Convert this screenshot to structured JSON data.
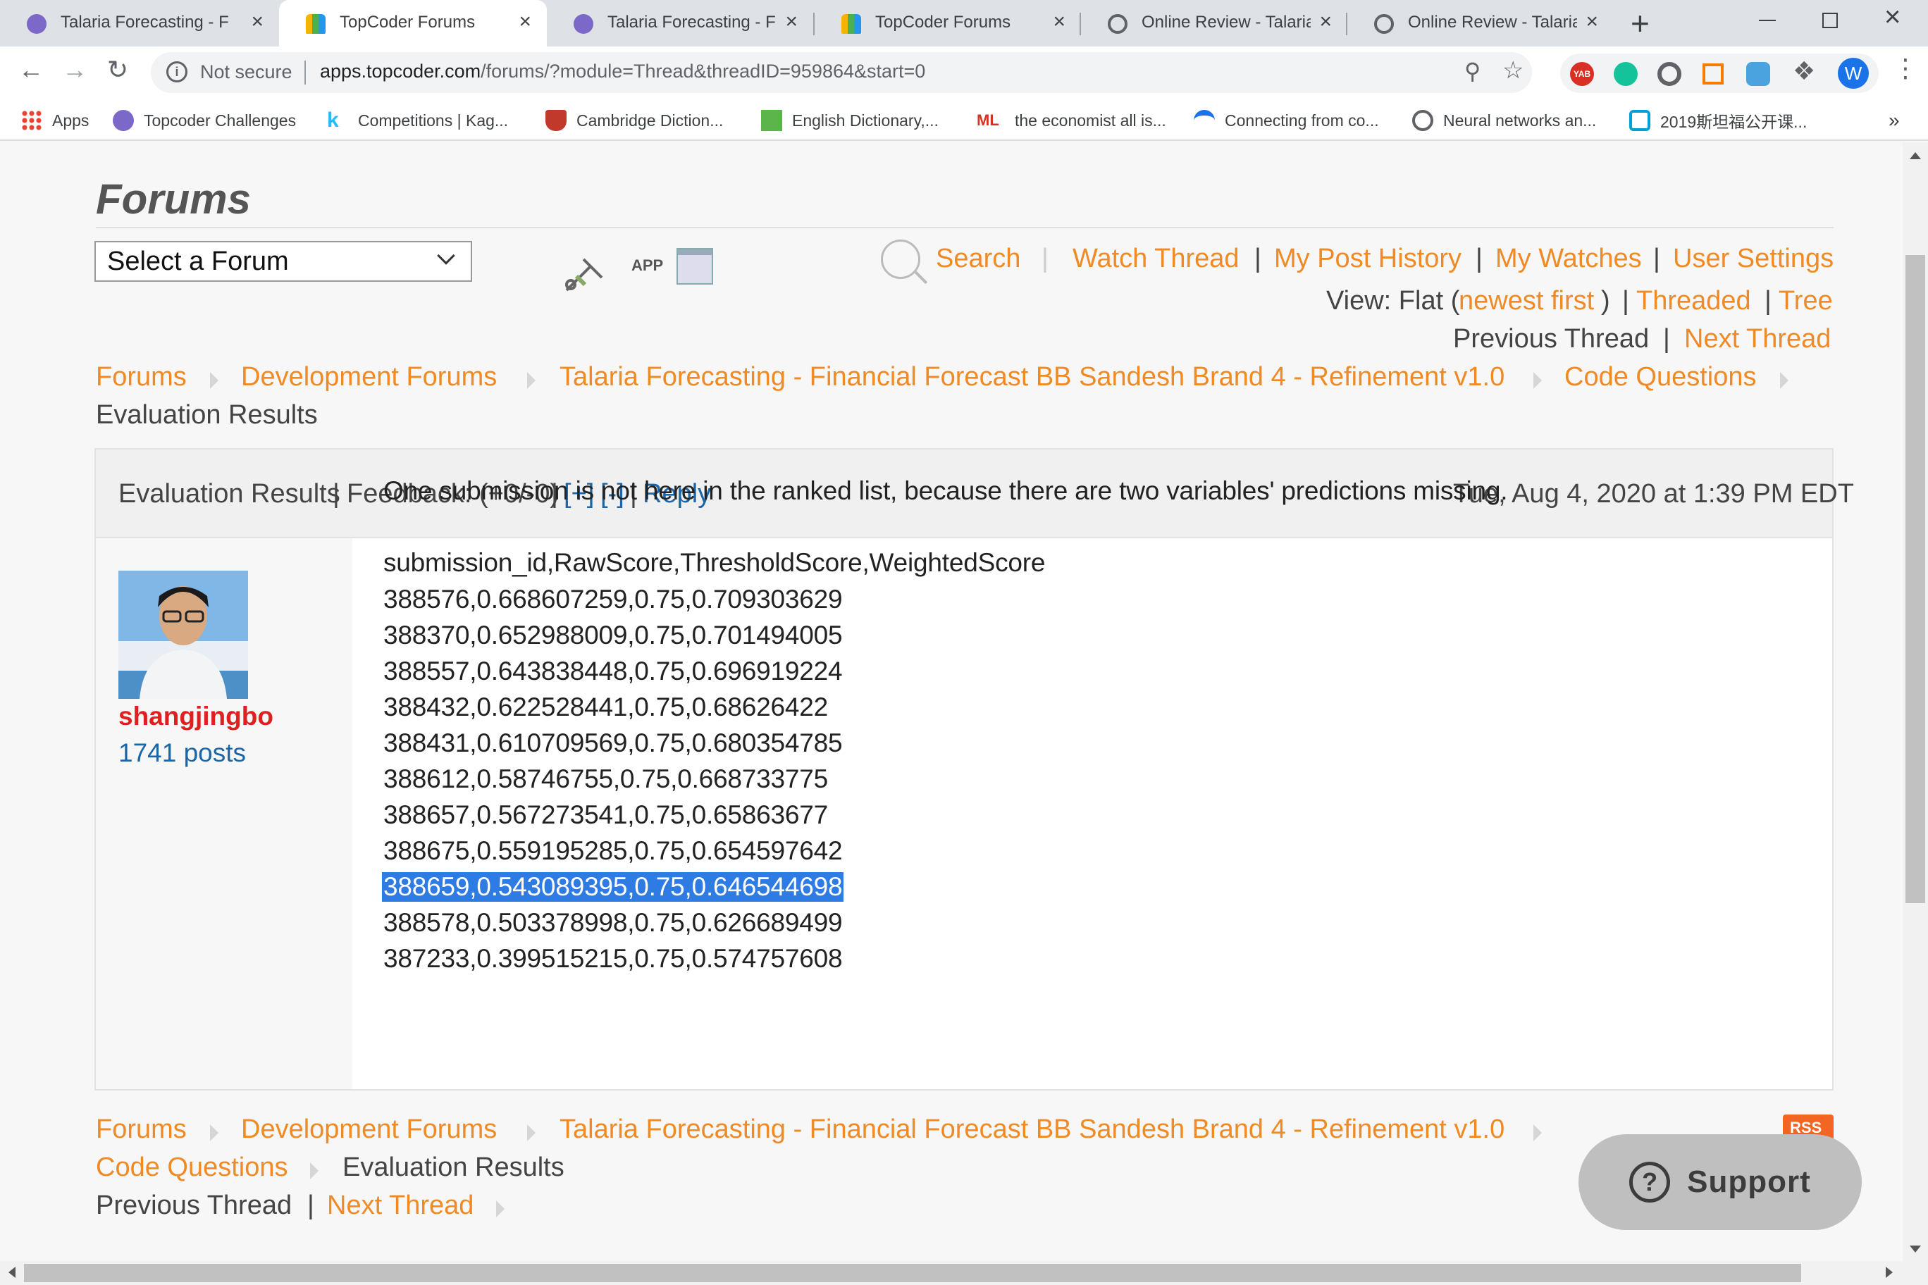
{
  "browser": {
    "tabs": [
      {
        "title": "Talaria Forecasting - Fin",
        "favicon": "topcoder-icon",
        "active": false
      },
      {
        "title": "TopCoder Forums",
        "favicon": "topcoder-forums-icon",
        "active": true
      },
      {
        "title": "Talaria Forecasting - Fin",
        "favicon": "topcoder-icon",
        "active": false
      },
      {
        "title": "TopCoder Forums",
        "favicon": "topcoder-forums-icon",
        "active": false
      },
      {
        "title": "Online Review - Talaria",
        "favicon": "globe-icon",
        "active": false
      },
      {
        "title": "Online Review - Talaria",
        "favicon": "globe-icon",
        "active": false
      }
    ],
    "security_label": "Not secure",
    "url_host": "apps.topcoder.com",
    "url_path": "/forums/?module=Thread&threadID=959864&start=0",
    "profile_initial": "W",
    "bookmarks": [
      "Apps",
      "Topcoder Challenges",
      "Competitions | Kag...",
      "Cambridge Diction...",
      "English Dictionary,...",
      "the economist all is...",
      "Connecting from co...",
      "Neural networks an...",
      "2019斯坦福公开课..."
    ],
    "bookmark_overflow": "»"
  },
  "forum": {
    "heading": "Forums",
    "select_label": "Select a Forum",
    "app_label": "APP",
    "nav": {
      "search": "Search",
      "watch_thread": "Watch Thread",
      "my_post_history": "My Post History",
      "my_watches": "My Watches",
      "user_settings": "User Settings",
      "sep": "|"
    },
    "view": {
      "prefix": "View: Flat (",
      "newest_first": "newest first",
      "close_paren": ")",
      "threaded": "Threaded",
      "tree": "Tree"
    },
    "prev_thread": "Previous Thread",
    "next_thread": "Next Thread",
    "breadcrumb": {
      "forums": "Forums",
      "development_forums": "Development Forums",
      "challenge": "Talaria Forecasting - Financial Forecast BB Sandesh Brand 4 - Refinement v1.0",
      "code_questions": "Code Questions",
      "current": "Evaluation Results"
    }
  },
  "post": {
    "subject": "Evaluation Results",
    "feedback": "Feedback: (+0/-0)",
    "plus": "[+]",
    "minus": "[-]",
    "reply": "Reply",
    "date": "Tue, Aug 4, 2020 at 1:39 PM EDT",
    "author": "shangjingbo",
    "author_posts": "1741 posts",
    "intro": "One submission is not here in the ranked list, because there are two variables' predictions missing.",
    "header_row": "submission_id,RawScore,ThresholdScore,WeightedScore",
    "rows": [
      "388576,0.668607259,0.75,0.709303629",
      "388370,0.652988009,0.75,0.701494005",
      "388557,0.643838448,0.75,0.696919224",
      "388432,0.622528441,0.75,0.68626422",
      "388431,0.610709569,0.75,0.680354785",
      "388612,0.58746755,0.75,0.668733775",
      "388657,0.567273541,0.75,0.65863677",
      "388675,0.559195285,0.75,0.654597642",
      "388659,0.543089395,0.75,0.646544698",
      "388578,0.503378998,0.75,0.626689499",
      "387233,0.399515215,0.75,0.574757608"
    ],
    "selected_row_index": 8
  },
  "footer": {
    "rss": "RSS",
    "support": "Support"
  },
  "colors": {
    "link_orange": "#f08a24",
    "link_blue": "#1a66a8",
    "author_red": "#e02020",
    "selection": "#2e7be4"
  }
}
